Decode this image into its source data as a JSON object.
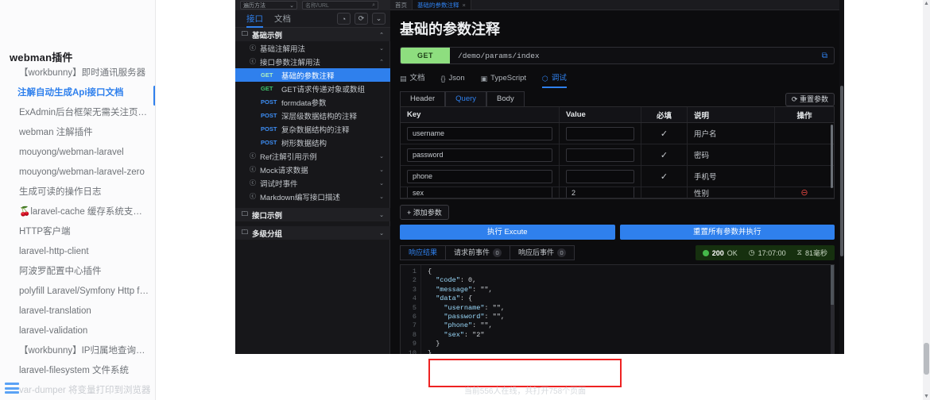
{
  "sidebar": {
    "title": "webman插件",
    "items": [
      {
        "label": "【workbunny】即时通讯服务器",
        "state": "normal"
      },
      {
        "label": "注解自动生成Api接口文档",
        "state": "active"
      },
      {
        "label": "ExAdmin后台框架无需关注页面模板Java...",
        "state": "normal"
      },
      {
        "label": "webman 注解插件",
        "state": "normal"
      },
      {
        "label": "mouyong/webman-laravel",
        "state": "normal"
      },
      {
        "label": "mouyong/webman-laravel-zero",
        "state": "normal"
      },
      {
        "label": "生成可读的操作日志",
        "state": "normal"
      },
      {
        "label": "🍒laravel-cache 缓存系统支持本地files/r...",
        "state": "normal"
      },
      {
        "label": "HTTP客户端",
        "state": "normal"
      },
      {
        "label": "laravel-http-client",
        "state": "normal"
      },
      {
        "label": "阿波罗配置中心插件",
        "state": "normal"
      },
      {
        "label": "polyfill Laravel/Symfony Http for webman",
        "state": "normal"
      },
      {
        "label": "laravel-translation",
        "state": "normal"
      },
      {
        "label": "laravel-validation",
        "state": "normal"
      },
      {
        "label": "【workbunny】IP归属地查询插件",
        "state": "normal"
      },
      {
        "label": "laravel-filesystem 文件系统",
        "state": "normal"
      },
      {
        "label": "var-dumper 将变量打印到浏览器",
        "state": "faded"
      }
    ],
    "menu_icon": "hamburger-icon"
  },
  "apidoc": {
    "tree": {
      "filter_value": "遍历方法",
      "search_placeholder": "名称/URL",
      "search_icon": "search-icon",
      "tools": [
        {
          "name": "tag-icon",
          "glyph": "◔"
        },
        {
          "name": "refresh-icon",
          "glyph": "⟳"
        },
        {
          "name": "chevron-down-icon",
          "glyph": "⌄"
        }
      ],
      "tabs": [
        {
          "label": "接口",
          "active": true
        },
        {
          "label": "文档",
          "active": false
        }
      ],
      "nodes": [
        {
          "type": "folder",
          "label": "基础示例",
          "icon": "folder-icon",
          "caret": "⌃",
          "indent": 6
        },
        {
          "type": "doc",
          "label": "基础注解用法",
          "icon": "copyright-icon",
          "caret": "⌄",
          "indent": 16
        },
        {
          "type": "doc",
          "label": "接口参数注解用法",
          "icon": "copyright-icon",
          "caret": "⌃",
          "indent": 16
        },
        {
          "type": "api",
          "verb": "GET",
          "label": "基础的参数注释",
          "selected": true,
          "indent": 32
        },
        {
          "type": "api",
          "verb": "GET",
          "label": "GET请求传递对象或数组",
          "indent": 32
        },
        {
          "type": "api",
          "verb": "POST",
          "label": "formdata参数",
          "indent": 32
        },
        {
          "type": "api",
          "verb": "POST",
          "label": "深层级数据结构的注释",
          "indent": 32
        },
        {
          "type": "api",
          "verb": "POST",
          "label": "复杂数据结构的注释",
          "indent": 32
        },
        {
          "type": "api",
          "verb": "POST",
          "label": "树形数据结构",
          "indent": 32
        },
        {
          "type": "doc",
          "label": "Ref注解引用示例",
          "icon": "copyright-icon",
          "caret": "⌄",
          "indent": 16
        },
        {
          "type": "doc",
          "label": "Mock请求数据",
          "icon": "copyright-icon",
          "caret": "⌄",
          "indent": 16
        },
        {
          "type": "doc",
          "label": "调试时事件",
          "icon": "copyright-icon",
          "caret": "⌄",
          "indent": 16
        },
        {
          "type": "doc",
          "label": "Markdown编写接口描述",
          "icon": "copyright-icon",
          "caret": "⌄",
          "indent": 16
        },
        {
          "type": "folder",
          "label": "接口示例",
          "icon": "folder-icon",
          "caret": "⌄",
          "indent": 6,
          "gap_before": true
        },
        {
          "type": "folder",
          "label": "多级分组",
          "icon": "folder-icon",
          "caret": "⌄",
          "indent": 6,
          "gap_before": true
        }
      ]
    },
    "doc_tabs": [
      {
        "label": "首页",
        "active": false
      },
      {
        "label": "基础的参数注释",
        "active": true,
        "close": "×"
      }
    ],
    "title": "基础的参数注释",
    "method": "GET",
    "url": "/demo/params/index",
    "copy_icon": "copy-icon",
    "view_tabs": [
      {
        "label": "文档",
        "icon": "document-icon",
        "glyph": "▤",
        "active": false
      },
      {
        "label": "Json",
        "icon": "json-icon",
        "glyph": "{}",
        "active": false
      },
      {
        "label": "TypeScript",
        "icon": "typescript-icon",
        "glyph": "▣",
        "active": false
      },
      {
        "label": "调试",
        "icon": "bug-icon",
        "glyph": "⬡",
        "active": true
      }
    ],
    "param_tabs": [
      {
        "label": "Header",
        "active": false
      },
      {
        "label": "Query",
        "active": true
      },
      {
        "label": "Body",
        "active": false
      }
    ],
    "reset_params_label": "重置参数",
    "reset_icon": "refresh-icon",
    "table": {
      "headers": [
        "Key",
        "Value",
        "必填",
        "说明",
        "操作"
      ],
      "rows": [
        {
          "key": "username",
          "value": "",
          "required": "✓",
          "desc": "用户名",
          "action": ""
        },
        {
          "key": "password",
          "value": "",
          "required": "✓",
          "desc": "密码",
          "action": ""
        },
        {
          "key": "phone",
          "value": "",
          "required": "✓",
          "desc": "手机号",
          "action": ""
        },
        {
          "key": "sex",
          "value": "2",
          "required": "",
          "desc": "性别",
          "action": "⊖",
          "clipped": true
        }
      ]
    },
    "add_param_label": "+ 添加参数",
    "execute_label": "执行 Excute",
    "reset_execute_label": "重置所有参数并执行",
    "response_tabs": [
      {
        "label": "响应结果",
        "active": true,
        "count": null
      },
      {
        "label": "请求前事件",
        "active": false,
        "count": "0"
      },
      {
        "label": "响应后事件",
        "active": false,
        "count": "0"
      }
    ],
    "status": {
      "code": "200",
      "code_text": "OK",
      "time": "17:07:00",
      "duration": "81毫秒",
      "clock_icon": "clock-icon",
      "timer_icon": "hourglass-icon",
      "status_icon": "success-dot-icon"
    },
    "response_json_lines": [
      {
        "n": "1",
        "text": "{"
      },
      {
        "n": "2",
        "text": "  \"code\": 0,"
      },
      {
        "n": "3",
        "text": "  \"message\": \"\","
      },
      {
        "n": "4",
        "text": "  \"data\": {"
      },
      {
        "n": "5",
        "text": "    \"username\": \"\","
      },
      {
        "n": "6",
        "text": "    \"password\": \"\","
      },
      {
        "n": "7",
        "text": "    \"phone\": \"\","
      },
      {
        "n": "8",
        "text": "    \"sex\": \"2\""
      },
      {
        "n": "9",
        "text": "  }"
      },
      {
        "n": "10",
        "text": "}"
      }
    ]
  },
  "footer": {
    "online_text": "当前556人在线，共打开758个页面"
  },
  "colors": {
    "accent_blue": "#2f80ed",
    "get_green": "#8ede7f",
    "post_blue": "#3d8ef5",
    "status_green": "#45b94a",
    "highlight_red": "#ee2222"
  }
}
